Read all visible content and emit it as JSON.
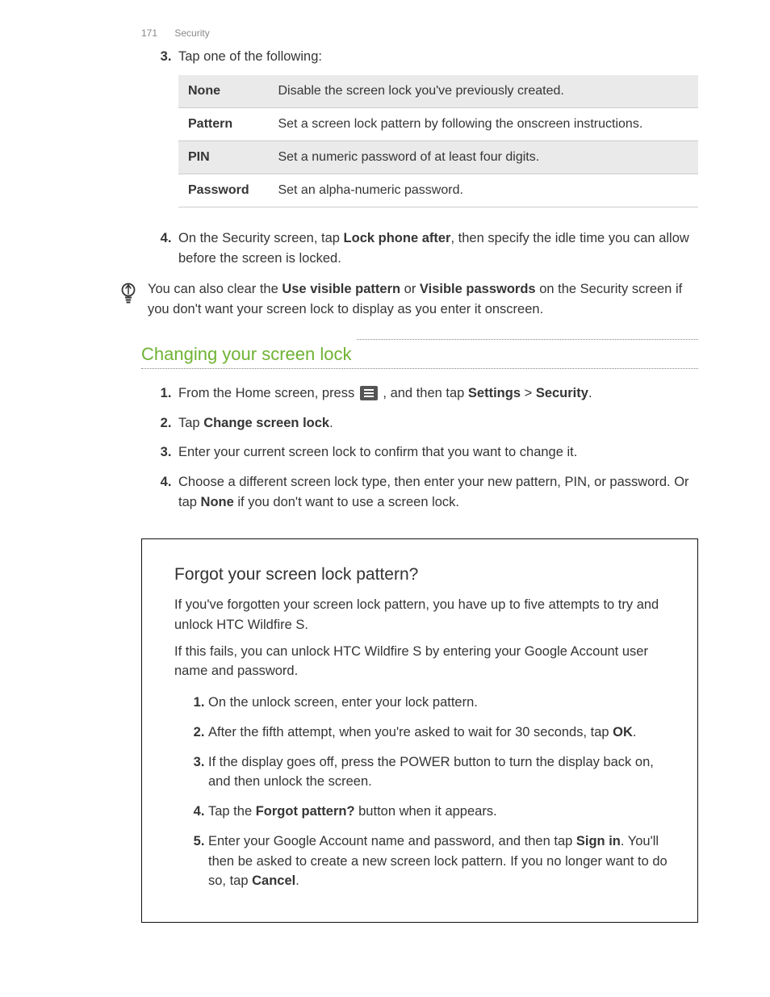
{
  "header": {
    "page_number": "171",
    "section": "Security"
  },
  "step3": {
    "number": "3.",
    "text": "Tap one of the following:",
    "table": {
      "rows": [
        {
          "name": "None",
          "desc": "Disable the screen lock you've previously created."
        },
        {
          "name": "Pattern",
          "desc": "Set a screen lock pattern by following the onscreen instructions."
        },
        {
          "name": "PIN",
          "desc": "Set a numeric password of at least four digits."
        },
        {
          "name": "Password",
          "desc": "Set an alpha-numeric password."
        }
      ]
    }
  },
  "step4": {
    "number": "4.",
    "pre": "On the Security screen, tap ",
    "bold": "Lock phone after",
    "post": ", then specify the idle time you can allow before the screen is locked."
  },
  "tip": {
    "pre": "You can also clear the ",
    "b1": "Use visible pattern",
    "mid": " or ",
    "b2": "Visible passwords",
    "post": " on the Security screen if you don't want your screen lock to display as you enter it onscreen."
  },
  "section_title": "Changing your screen lock",
  "change": {
    "s1": {
      "pre": "From the Home screen, press ",
      "mid": " , and then tap ",
      "b1": "Settings",
      "gt": " > ",
      "b2": "Security",
      "post": "."
    },
    "s2": {
      "pre": "Tap ",
      "b1": "Change screen lock",
      "post": "."
    },
    "s3": "Enter your current screen lock to confirm that you want to change it.",
    "s4": {
      "pre": "Choose a different screen lock type, then enter your new pattern, PIN, or password. Or tap ",
      "b1": "None",
      "post": " if you don't want to use a screen lock."
    }
  },
  "forgot": {
    "title": "Forgot your screen lock pattern?",
    "p1": "If you've forgotten your screen lock pattern, you have up to five attempts to try and unlock HTC Wildfire S.",
    "p2": "If this fails, you can unlock HTC Wildfire S by entering your Google Account user name and password.",
    "s1": "On the unlock screen, enter your lock pattern.",
    "s2": {
      "pre": "After the fifth attempt, when you're asked to wait for 30 seconds, tap ",
      "b1": "OK",
      "post": "."
    },
    "s3": "If the display goes off, press the POWER button to turn the display back on, and then unlock the screen.",
    "s4": {
      "pre": "Tap the ",
      "b1": "Forgot pattern?",
      "post": " button when it appears."
    },
    "s5": {
      "pre": "Enter your Google Account name and password, and then tap ",
      "b1": "Sign in",
      "mid": ". You'll then be asked to create a new screen lock pattern. If you no longer want to do so, tap ",
      "b2": "Cancel",
      "post": "."
    }
  }
}
